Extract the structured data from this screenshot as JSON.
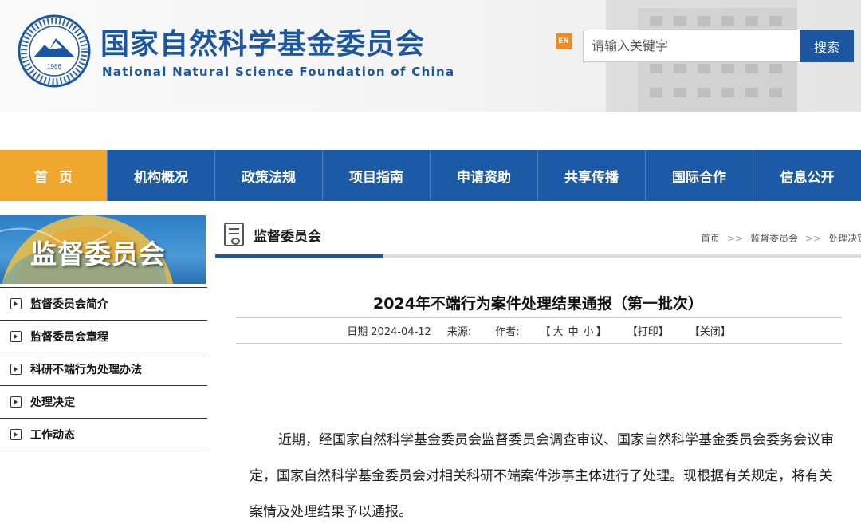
{
  "header": {
    "site_name_cn": "国家自然科学基金委员会",
    "site_name_en": "National Natural Science Foundation of China",
    "logo_year": "1986",
    "en_switch": "EN",
    "search": {
      "placeholder": "请输入关键字",
      "button_label": "搜索"
    }
  },
  "nav": {
    "items": [
      "首页",
      "机构概况",
      "政策法规",
      "项目指南",
      "申请资助",
      "共享传播",
      "国际合作",
      "信息公开"
    ],
    "active_index": 0
  },
  "sidebar": {
    "banner_title": "监督委员会",
    "items": [
      "监督委员会简介",
      "监督委员会章程",
      "科研不端行为处理办法",
      "处理决定",
      "工作动态"
    ]
  },
  "section": {
    "title": "监督委员会",
    "breadcrumb": [
      "首页",
      "监督委员会",
      "处理决定"
    ],
    "breadcrumb_sep": ">>"
  },
  "article": {
    "title": "2024年不端行为案件处理结果通报（第一批次）",
    "date_label": "日期",
    "date": "2024-04-12",
    "source_label": "来源:",
    "author_label": "作者:",
    "font_size_open": "【",
    "font_sizes": [
      "大",
      "中",
      "小"
    ],
    "font_size_close": "】",
    "print": "【打印】",
    "close": "【关闭】",
    "body": "近期，经国家自然科学基金委员会监督委员会调查审议、国家自然科学基金委员会委务会议审定，国家自然科学基金委员会对相关科研不端案件涉事主体进行了处理。现根据有关规定，将有关案情及处理结果予以通报。"
  },
  "colors": {
    "brand_blue": "#1d56a0",
    "nav_blue": "#1d5aa6",
    "active_orange": "#f0a72e",
    "en_orange": "#f08a22"
  }
}
